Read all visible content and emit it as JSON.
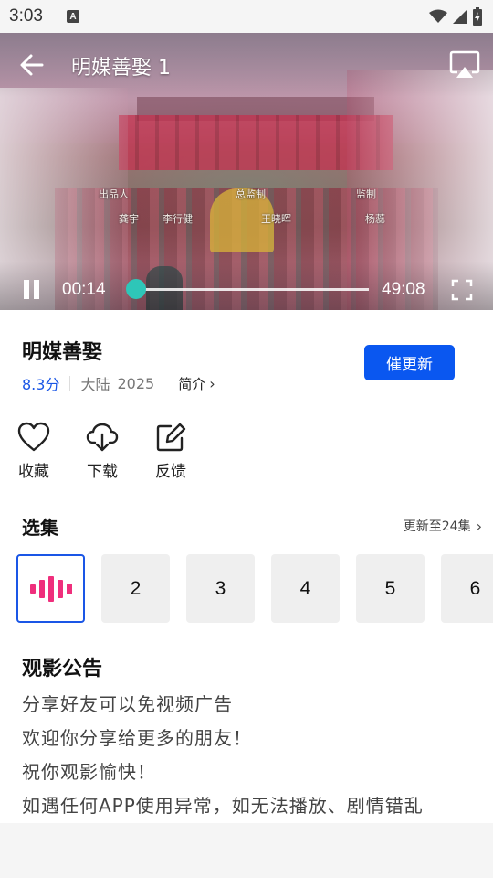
{
  "status_bar": {
    "time": "3:03",
    "keyboard_indicator": "A",
    "icons": [
      "wifi-icon",
      "signal-icon",
      "battery-charging-icon"
    ]
  },
  "player": {
    "title": "明媒善娶 1",
    "current_time": "00:14",
    "total_time": "49:08",
    "progress": 0.005,
    "accent_color": "#2ec6b8",
    "credits": [
      "出品人",
      "总监制",
      "监制",
      "龚宇",
      "李行健",
      "王晓晖",
      "杨蕊"
    ]
  },
  "show": {
    "title": "明媒善娶",
    "score": "8.3分",
    "region": "大陆",
    "year": "2025",
    "intro_label": "简介",
    "urge_update_label": "催更新",
    "accent_color": "#0a57f0"
  },
  "actions": [
    {
      "label": "收藏",
      "icon": "heart-icon"
    },
    {
      "label": "下载",
      "icon": "cloud-download-icon"
    },
    {
      "label": "反馈",
      "icon": "edit-icon"
    }
  ],
  "episodes": {
    "title": "选集",
    "update_status": "更新至24集",
    "current_indicator": "playing-bars-icon",
    "items": [
      "2",
      "3",
      "4",
      "5",
      "6"
    ]
  },
  "notice": {
    "title": "观影公告",
    "lines": [
      "分享好友可以免视频广告",
      "欢迎你分享给更多的朋友！",
      "祝你观影愉快！",
      "如遇任何APP使用异常，如无法播放、剧情错乱"
    ]
  }
}
